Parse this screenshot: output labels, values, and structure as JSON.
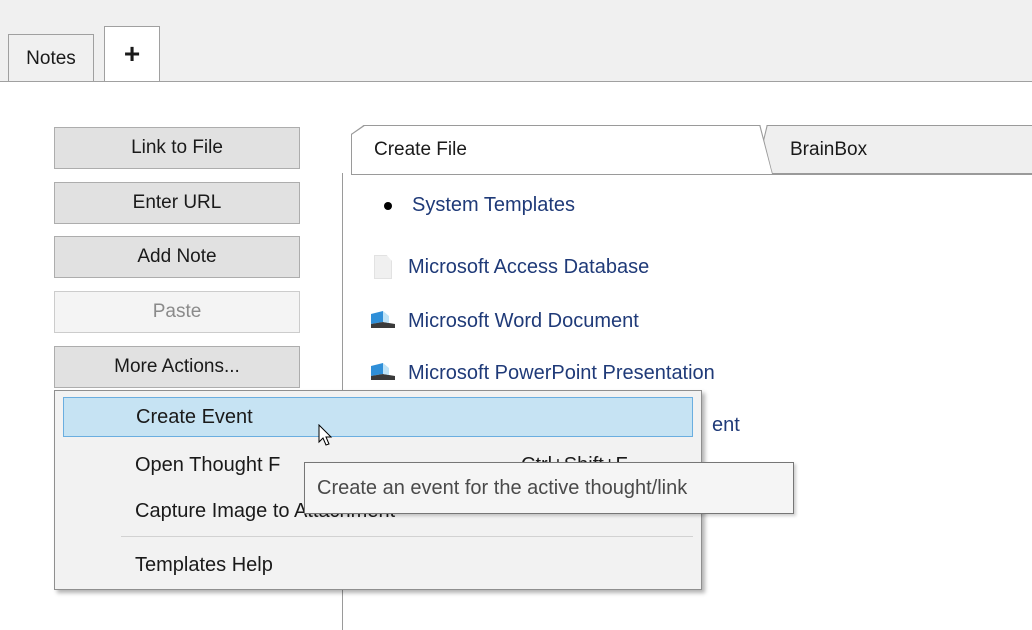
{
  "top_tabs": {
    "notes": "Notes",
    "add": "+"
  },
  "actions": {
    "link_to_file": "Link to File",
    "enter_url": "Enter URL",
    "add_note": "Add Note",
    "paste": "Paste",
    "more_actions": "More Actions..."
  },
  "inner_tabs": {
    "create_file": "Create File",
    "brainbox": "BrainBox"
  },
  "templates": {
    "system": "System Templates",
    "access": "Microsoft Access Database",
    "word": "Microsoft Word Document",
    "powerpoint": "Microsoft PowerPoint Presentation",
    "partial_behind_menu": "ent"
  },
  "menu": {
    "create_event": "Create Event",
    "open_thought": "Open Thought F",
    "open_thought_shortcut": "Ctrl+Shift+F",
    "capture_image": "Capture Image to Attachment",
    "templates_help": "Templates Help"
  },
  "tooltip": "Create an event for the active thought/link",
  "colors": {
    "link": "#1f3a78",
    "hover_bg": "#c6e3f3",
    "hover_border": "#6aaee0"
  }
}
